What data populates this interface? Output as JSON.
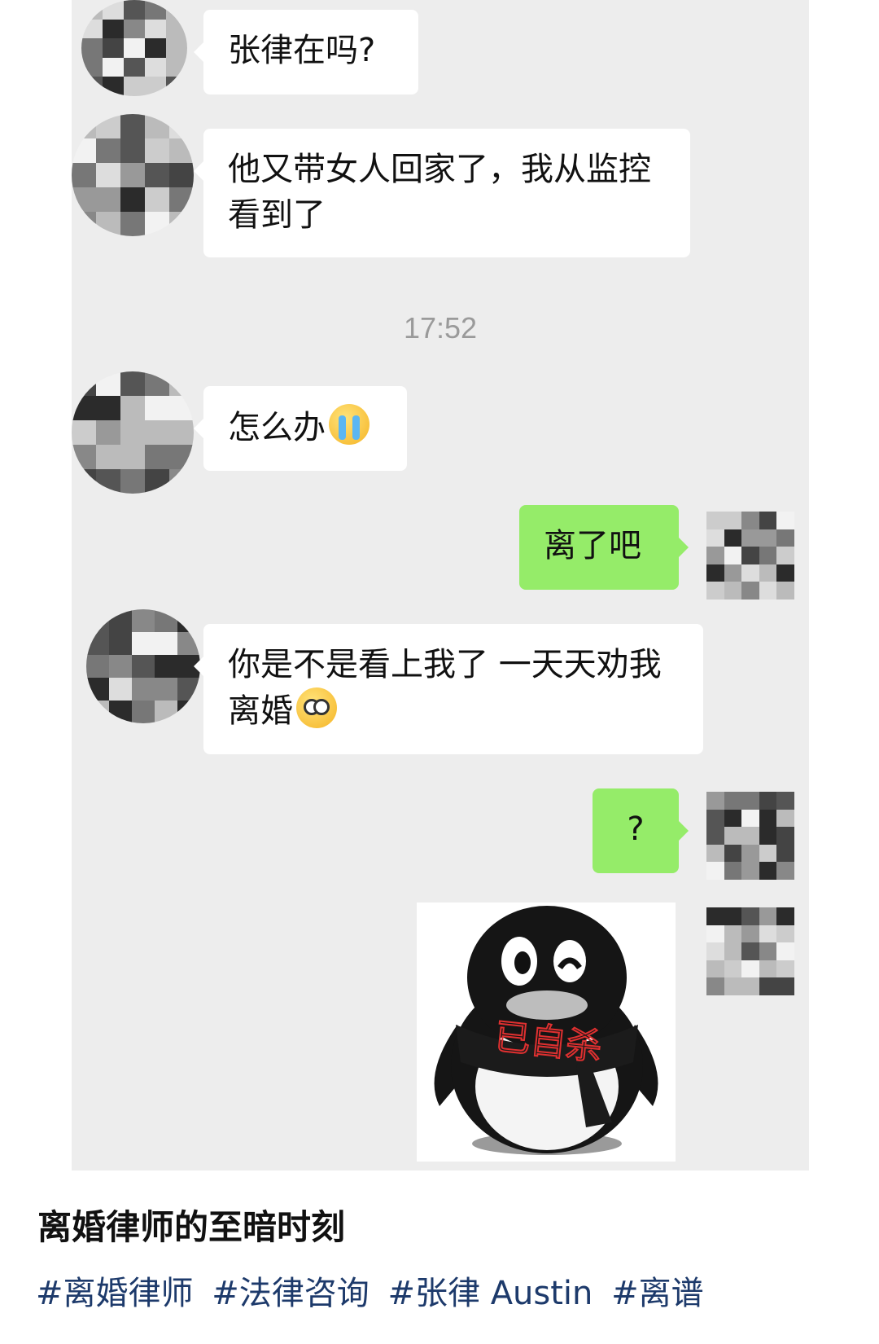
{
  "messages": [
    {
      "text": "张律在吗?"
    },
    {
      "text": "他又带女人回家了，我从监控看到了"
    },
    {
      "text": "怎么办",
      "emoji": "crying-emoji"
    },
    {
      "text": "离了吧"
    },
    {
      "text": "你是不是看上我了 一天天劝我离婚",
      "emoji": "shocked-emoji"
    },
    {
      "text": "?"
    }
  ],
  "timestamp": "17:52",
  "sticker": {
    "icon": "penguin-icon",
    "text": "已自杀"
  },
  "caption": {
    "title": "离婚律师的至暗时刻"
  },
  "hashtags": [
    "#离婚律师",
    "#法律咨询",
    "#张律 Austin",
    "#离谱"
  ],
  "colors": {
    "chat_bg": "#ededed",
    "incoming_bubble": "#ffffff",
    "outgoing_bubble": "#95ec69",
    "hashtag": "#1d3a6b"
  }
}
